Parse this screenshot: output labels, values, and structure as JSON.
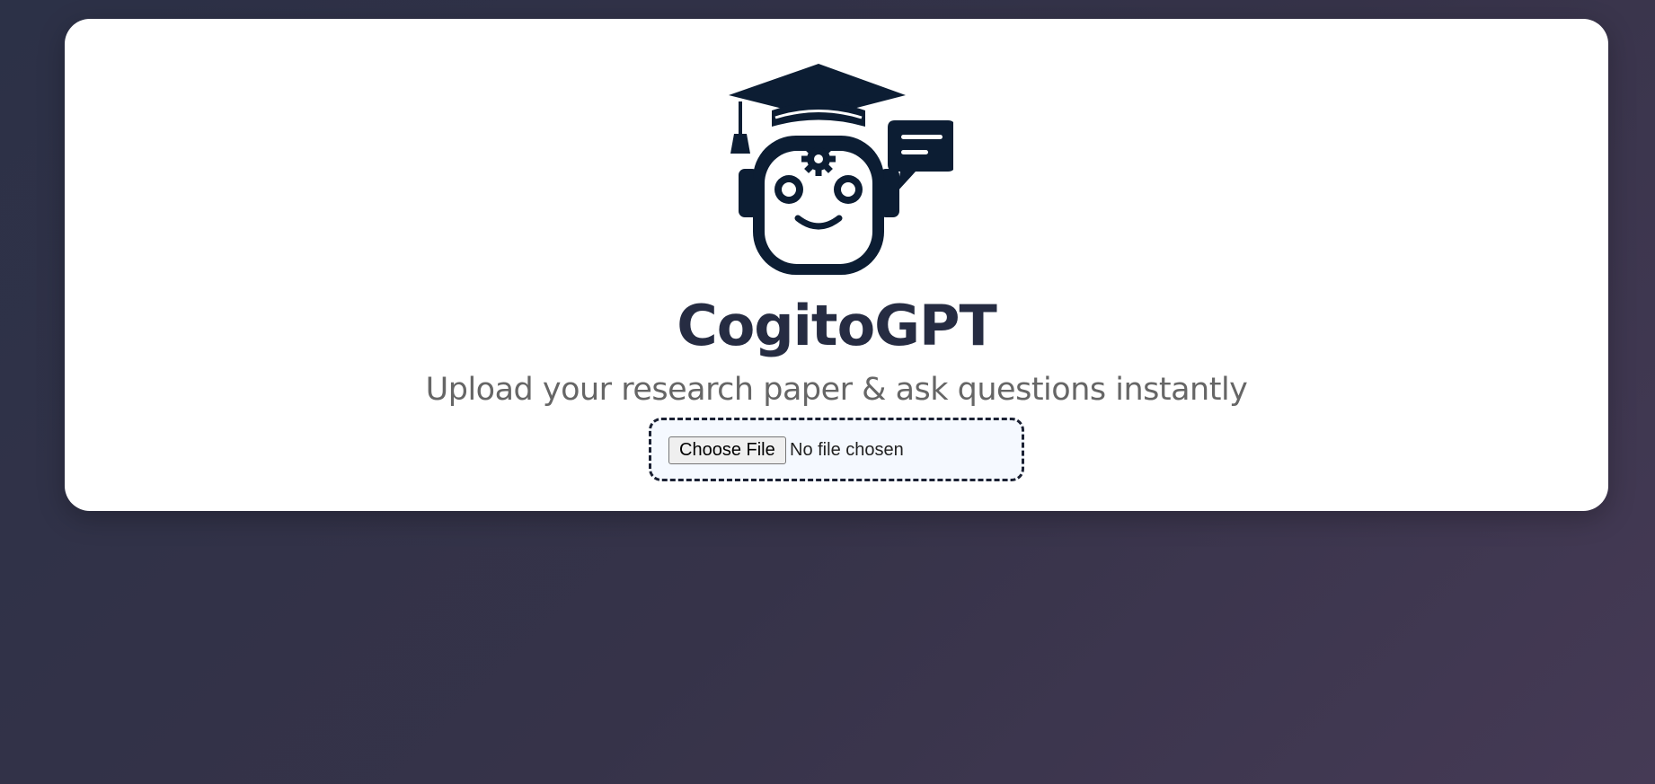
{
  "app": {
    "title": "CogitoGPT",
    "subtitle": "Upload your research paper & ask questions instantly",
    "logo_icon": "graduate-robot-chat-icon"
  },
  "upload": {
    "button_label": "Choose File",
    "status_text": "No file chosen"
  },
  "colors": {
    "background_start": "#2c3147",
    "background_end": "#453a55",
    "card": "#ffffff",
    "title": "#262c42",
    "subtitle": "#666666",
    "logo": "#0c1d33",
    "upload_bg": "#f5f9ff",
    "upload_border": "#1b2133"
  }
}
